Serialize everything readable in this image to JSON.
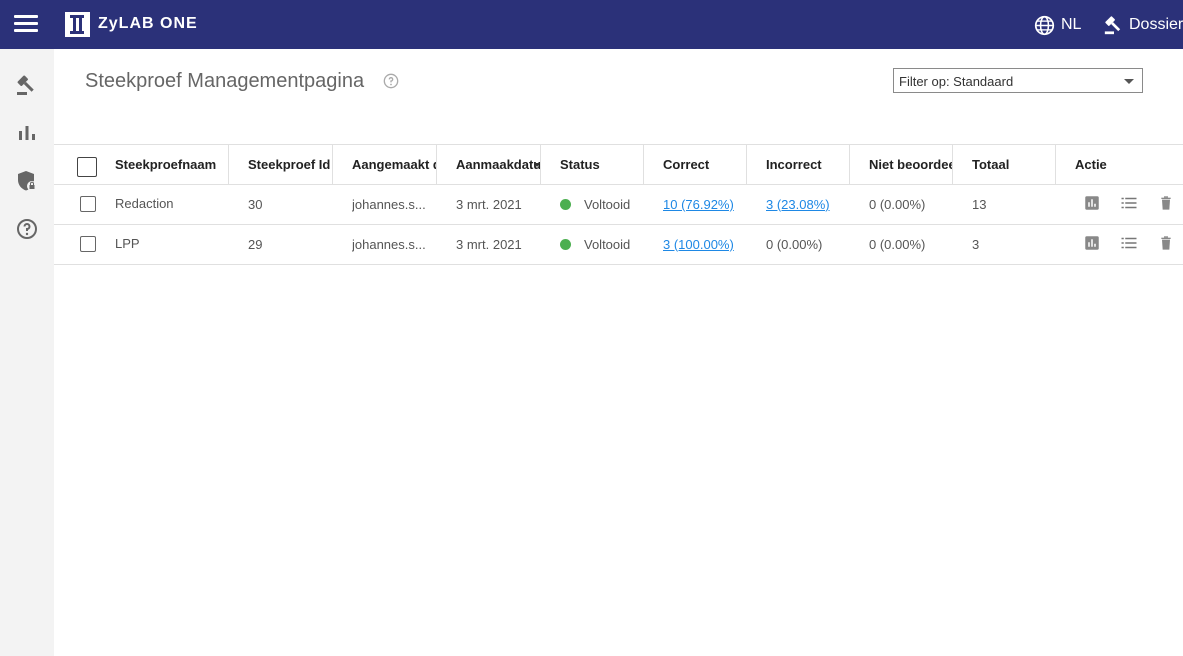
{
  "header": {
    "brand": "ZyLAB ONE",
    "language": "NL",
    "dossier": "Dossier"
  },
  "page": {
    "title": "Steekproef Managementpagina"
  },
  "filter": {
    "label": "Filter op: Standaard"
  },
  "table": {
    "columns": [
      "Steekproefnaam",
      "Steekproef Id",
      "Aangemaakt door",
      "Aanmaakdatum",
      "Status",
      "Correct",
      "Incorrect",
      "Niet beoordeeld",
      "Totaal",
      "Actie"
    ],
    "rows": [
      {
        "name": "Redaction",
        "id": "30",
        "created_by": "johannes.s...",
        "date": "3 mrt. 2021",
        "status": "Voltooid",
        "correct": "10 (76.92%)",
        "incorrect": "3 (23.08%)",
        "not_reviewed": "0 (0.00%)",
        "total": "13"
      },
      {
        "name": "LPP",
        "id": "29",
        "created_by": "johannes.s...",
        "date": "3 mrt. 2021",
        "status": "Voltooid",
        "correct": "3 (100.00%)",
        "incorrect": "0 (0.00%)",
        "not_reviewed": "0 (0.00%)",
        "total": "3"
      }
    ]
  },
  "colors": {
    "topbar": "#2b3179",
    "status_ok": "#4caf50",
    "link": "#1e88e5"
  }
}
